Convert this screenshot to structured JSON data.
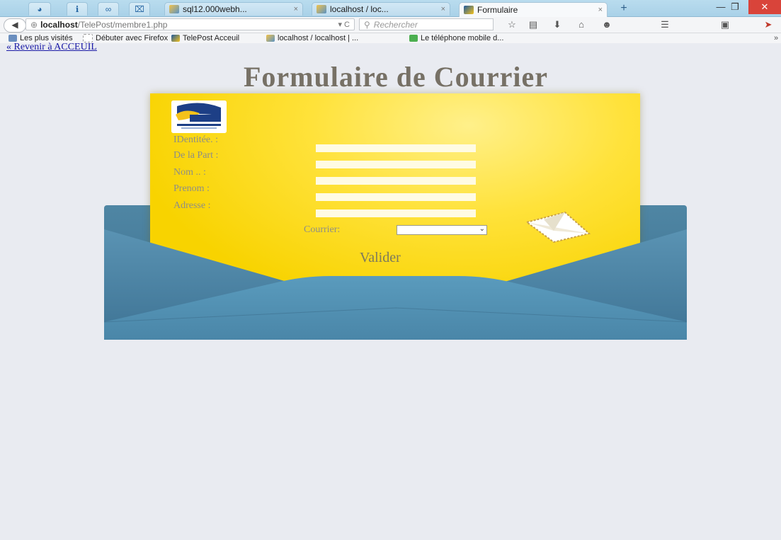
{
  "browser": {
    "tabs": [
      {
        "label": "sql12.000webh...",
        "close": "×"
      },
      {
        "label": "localhost / loc...",
        "close": "×"
      },
      {
        "label": "Formulaire",
        "close": "×"
      }
    ],
    "new_tab": "+",
    "window": {
      "minimize": "—",
      "restore": "❐",
      "close": "✕"
    },
    "url_host": "localhost",
    "url_path": "/TelePost/membre1.php",
    "search_placeholder": "Rechercher",
    "bookmarks": [
      "Les plus visités",
      "Débuter avec Firefox",
      "TelePost Acceuil",
      "localhost / localhost | ...",
      "Le téléphone mobile d..."
    ],
    "overflow": "»"
  },
  "page": {
    "back_link": "« Revenir à ACCEUIL",
    "title": "Formulaire de Courrier",
    "form": {
      "labels": [
        "IDentitée. :",
        "De la Part :",
        "Nom .. :",
        "Prenom :",
        "Adresse :"
      ],
      "fields": [
        "",
        "",
        "",
        "",
        ""
      ],
      "courrier_label": "Courrier:",
      "courrier_value": "",
      "submit": "Valider"
    }
  },
  "colors": {
    "letter": "#ffe23a",
    "envelope": "#4a82a2",
    "title": "#777166"
  }
}
